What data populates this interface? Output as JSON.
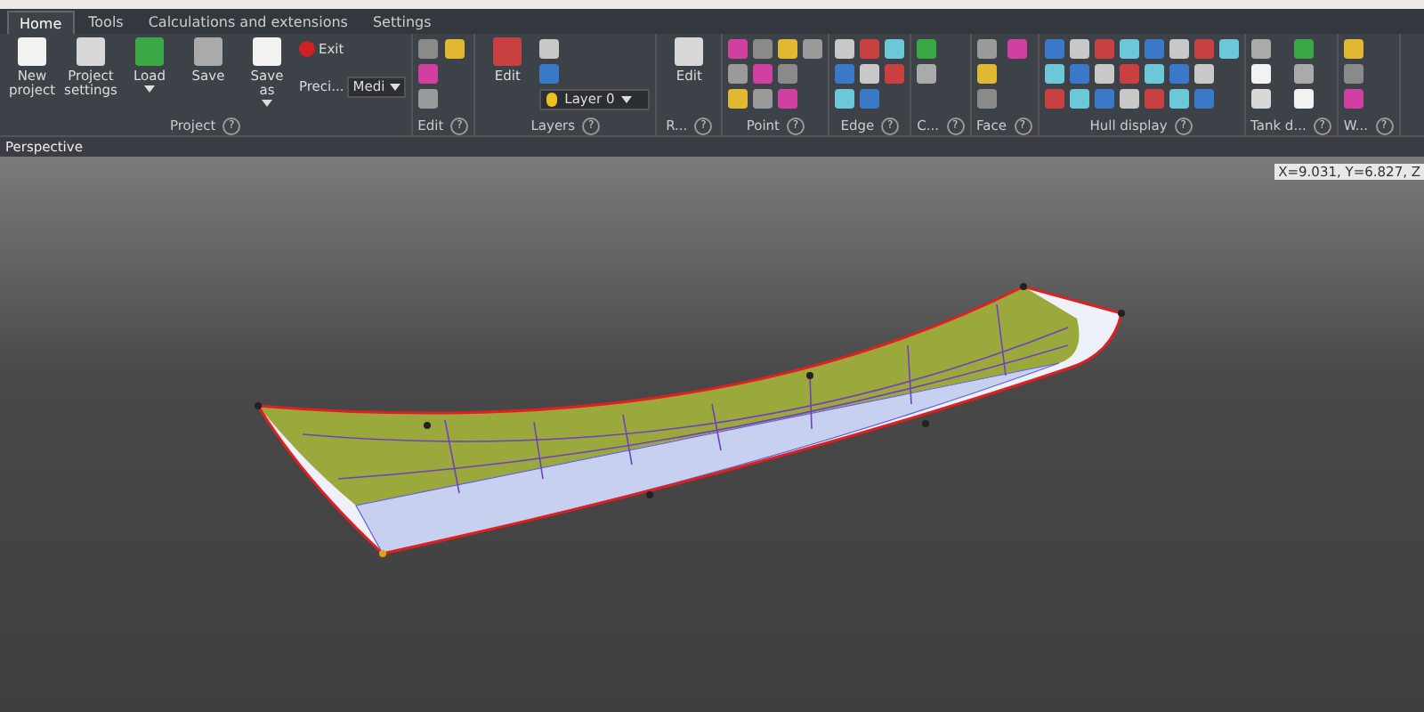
{
  "tabs": [
    {
      "label": "Home",
      "selected": true
    },
    {
      "label": "Tools",
      "selected": false
    },
    {
      "label": "Calculations and extensions",
      "selected": false
    },
    {
      "label": "Settings",
      "selected": false
    }
  ],
  "groups": [
    {
      "label": "Project",
      "help": "?",
      "items": [
        {
          "kind": "large",
          "label": "New project",
          "caret": false
        },
        {
          "kind": "large",
          "label": "Project settings",
          "caret": false
        },
        {
          "kind": "large",
          "label": "Load",
          "caret": true
        },
        {
          "kind": "large",
          "label": "Save",
          "caret": false
        },
        {
          "kind": "large",
          "label": "Save as",
          "caret": true
        },
        {
          "kind": "exit",
          "label": "Exit"
        },
        {
          "kind": "select",
          "label": "Preci...",
          "value": "Medi"
        }
      ]
    },
    {
      "label": "Edit",
      "help": "?",
      "items": [
        {
          "kind": "icon"
        },
        {
          "kind": "icon"
        },
        {
          "kind": "icon"
        },
        {
          "kind": "icon"
        }
      ]
    },
    {
      "label": "Layers",
      "help": "?",
      "items": [
        {
          "kind": "large",
          "label": "Edit",
          "caret": false
        },
        {
          "kind": "icon"
        },
        {
          "kind": "icon"
        },
        {
          "kind": "layer",
          "value": "Layer 0"
        }
      ]
    },
    {
      "label": "R...",
      "help": "?",
      "items": [
        {
          "kind": "large",
          "label": "Edit",
          "caret": false
        }
      ]
    },
    {
      "label": "Point",
      "help": "?",
      "items": [
        {
          "kind": "icon"
        },
        {
          "kind": "icon"
        },
        {
          "kind": "icon"
        },
        {
          "kind": "icon"
        },
        {
          "kind": "icon"
        },
        {
          "kind": "icon"
        },
        {
          "kind": "icon"
        },
        {
          "kind": "icon"
        },
        {
          "kind": "icon"
        },
        {
          "kind": "icon"
        }
      ]
    },
    {
      "label": "Edge",
      "help": "?",
      "items": [
        {
          "kind": "icon"
        },
        {
          "kind": "icon"
        },
        {
          "kind": "icon"
        },
        {
          "kind": "icon"
        },
        {
          "kind": "icon"
        },
        {
          "kind": "icon"
        },
        {
          "kind": "icon"
        },
        {
          "kind": "icon"
        }
      ]
    },
    {
      "label": "C...",
      "help": "?",
      "items": [
        {
          "kind": "icon"
        },
        {
          "kind": "icon"
        }
      ]
    },
    {
      "label": "Face",
      "help": "?",
      "items": [
        {
          "kind": "icon"
        },
        {
          "kind": "icon"
        },
        {
          "kind": "icon"
        },
        {
          "kind": "icon"
        }
      ]
    },
    {
      "label": "Hull display",
      "help": "?",
      "items": [
        {
          "kind": "icon"
        },
        {
          "kind": "icon"
        },
        {
          "kind": "icon"
        },
        {
          "kind": "icon"
        },
        {
          "kind": "icon"
        },
        {
          "kind": "icon"
        },
        {
          "kind": "icon"
        },
        {
          "kind": "icon"
        },
        {
          "kind": "icon"
        },
        {
          "kind": "icon"
        },
        {
          "kind": "icon"
        },
        {
          "kind": "icon"
        },
        {
          "kind": "icon"
        },
        {
          "kind": "icon"
        },
        {
          "kind": "icon"
        },
        {
          "kind": "icon"
        },
        {
          "kind": "icon"
        },
        {
          "kind": "icon"
        },
        {
          "kind": "icon"
        },
        {
          "kind": "icon"
        },
        {
          "kind": "icon"
        },
        {
          "kind": "icon"
        }
      ]
    },
    {
      "label": "Tank d...",
      "help": "?",
      "items": [
        {
          "kind": "icon"
        },
        {
          "kind": "icon"
        },
        {
          "kind": "icon"
        },
        {
          "kind": "icon"
        },
        {
          "kind": "icon"
        },
        {
          "kind": "icon"
        }
      ]
    },
    {
      "label": "W...",
      "help": "?",
      "items": [
        {
          "kind": "icon"
        },
        {
          "kind": "icon"
        },
        {
          "kind": "icon"
        }
      ]
    }
  ],
  "viewport": {
    "label": "Perspective",
    "coordinates": "X=9.031, Y=6.827, Z"
  }
}
